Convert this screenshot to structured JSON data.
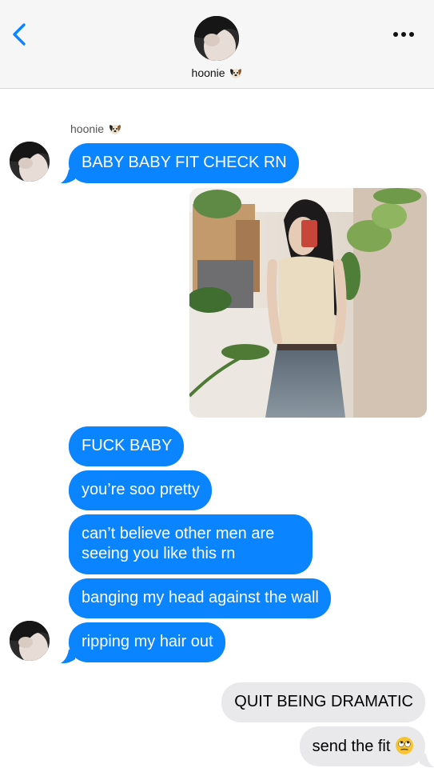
{
  "header": {
    "contact_name": "hoonie",
    "back_icon": "chevron-left-icon",
    "more_icon": "more-dots-icon",
    "name_emoji": "dog-emoji-icon"
  },
  "thread": {
    "sender_name": "hoonie",
    "messages": [
      {
        "side": "in",
        "text": "BABY BABY FIT CHECK RN"
      },
      {
        "side": "in",
        "type": "photo",
        "alt": "mirror selfie photo"
      },
      {
        "side": "in",
        "text": "FUCK BABY"
      },
      {
        "side": "in",
        "text": "you’re soo pretty"
      },
      {
        "side": "in",
        "text": "can’t believe other men are seeing you like this rn"
      },
      {
        "side": "in",
        "text": "banging my head against the wall"
      },
      {
        "side": "in",
        "text": "ripping my hair out"
      },
      {
        "side": "out",
        "text": "QUIT BEING DRAMATIC"
      },
      {
        "side": "out",
        "text": "send the fit",
        "emoji": "eye-roll-emoji-icon"
      }
    ]
  },
  "colors": {
    "incoming_bubble": "#0a84ff",
    "outgoing_bubble": "#e9e9eb",
    "header_bg": "#f6f6f6",
    "accent": "#0a84ff"
  }
}
